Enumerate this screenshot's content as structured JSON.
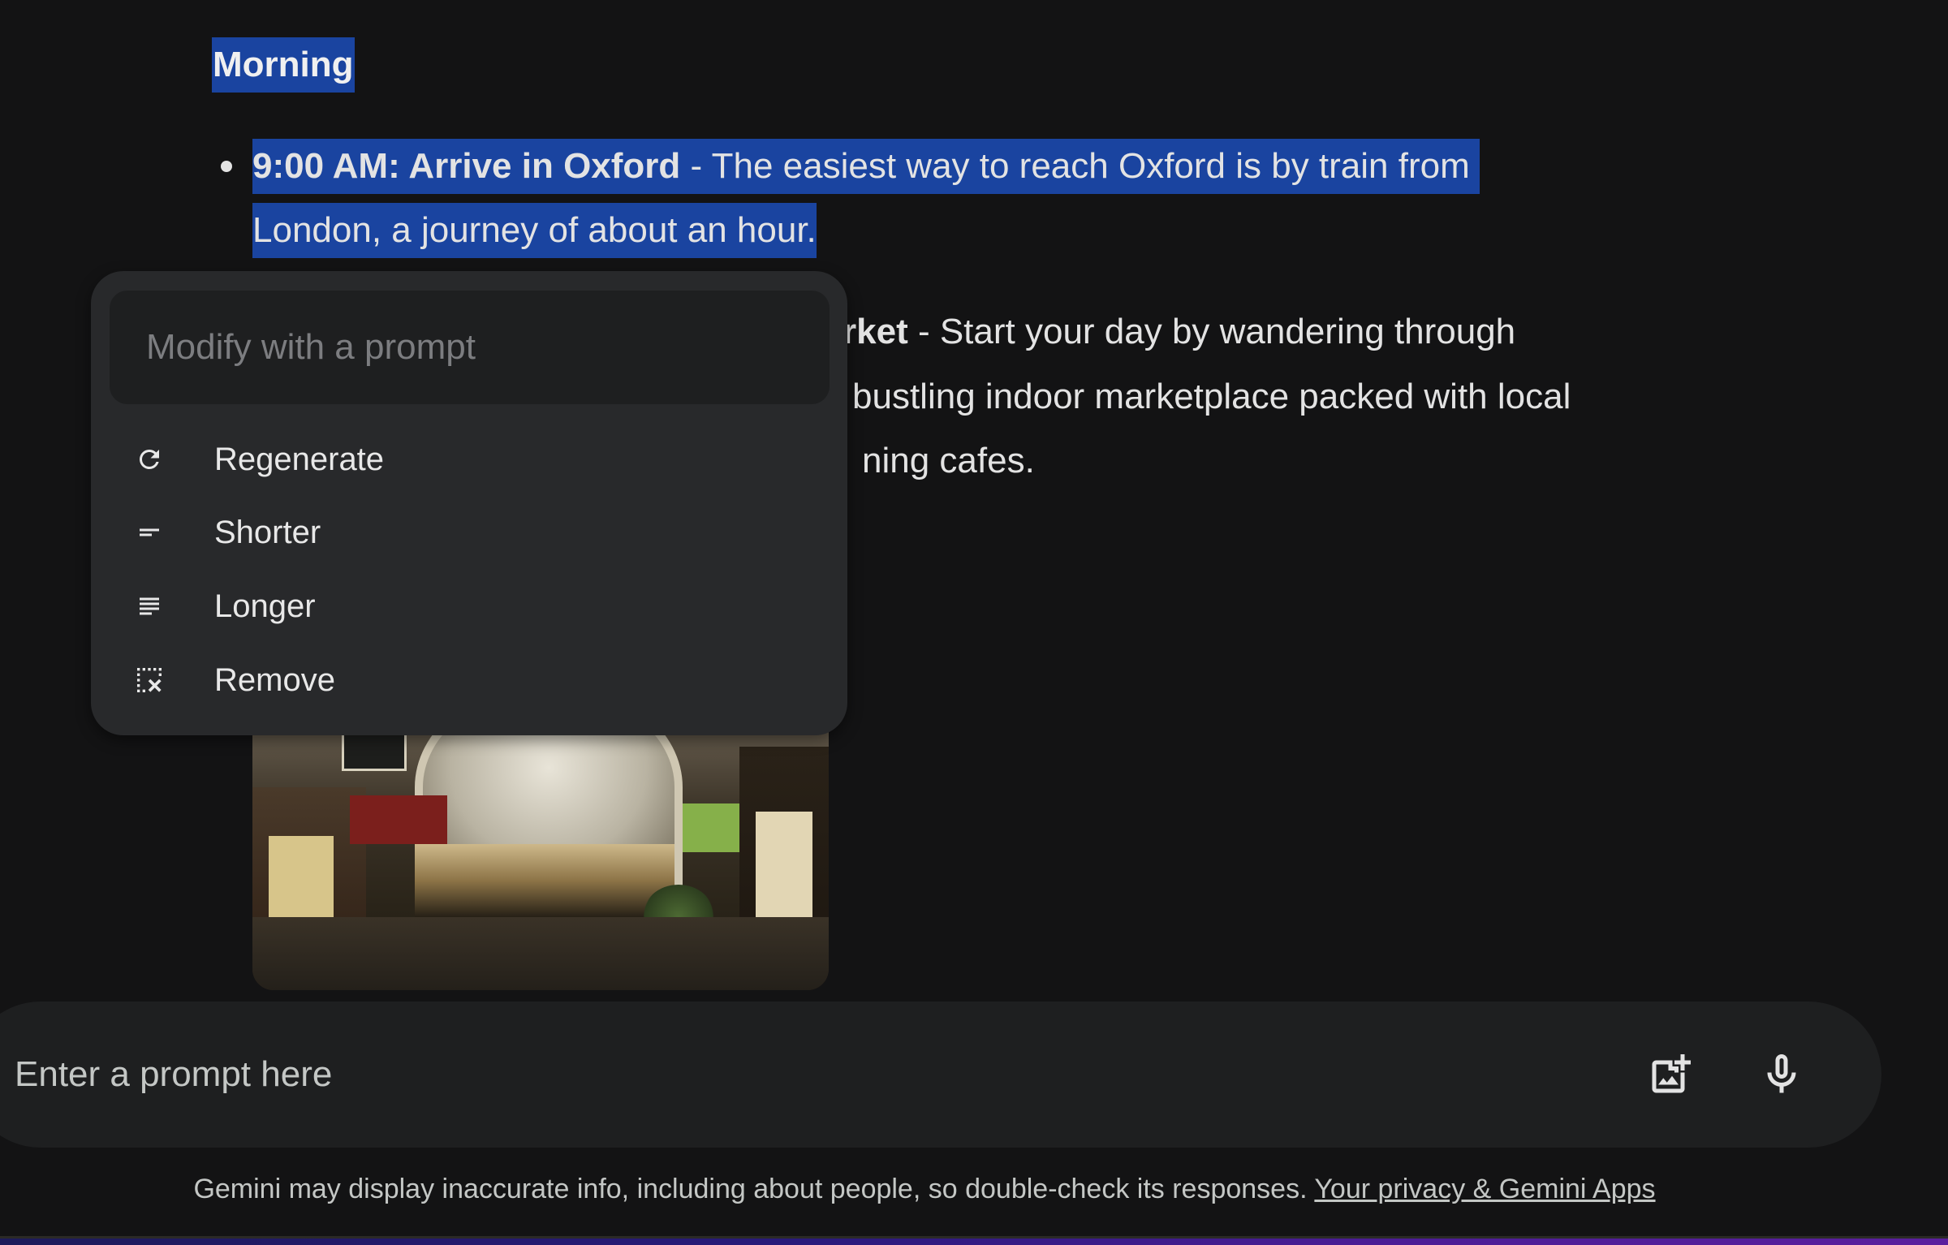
{
  "response": {
    "section_heading": "Morning",
    "items": [
      {
        "title": "9:00 AM: Arrive in Oxford",
        "separator": " - ",
        "line1_rest": " The easiest way to reach Oxford is by train from",
        "line2": "London, a journey of about an hour."
      },
      {
        "title_visible_fragment": "rket",
        "separator": " - ",
        "line1_rest": "Start your day by wandering through",
        "line2_fragment": "bustling indoor marketplace packed with local",
        "line3_fragment": "ning cafes."
      }
    ],
    "image": {
      "alt": "Interior of an indoor covered market with shops and arched roof"
    }
  },
  "popup": {
    "input_placeholder": "Modify with a prompt",
    "items": [
      {
        "label": "Regenerate",
        "icon": "refresh-icon"
      },
      {
        "label": "Shorter",
        "icon": "short-text-icon"
      },
      {
        "label": "Longer",
        "icon": "long-text-icon"
      },
      {
        "label": "Remove",
        "icon": "remove-selection-icon"
      }
    ]
  },
  "prompt_bar": {
    "placeholder": "Enter a prompt here",
    "icons": [
      "add-image-icon",
      "microphone-icon"
    ]
  },
  "footer": {
    "disclaimer": "Gemini may display inaccurate info, including about people, so double-check its responses. ",
    "link_label": "Your privacy & Gemini Apps"
  },
  "colors": {
    "background": "#131314",
    "selection": "#1a44a0",
    "popup_bg": "#28292b",
    "input_bg": "#1e1f20"
  }
}
